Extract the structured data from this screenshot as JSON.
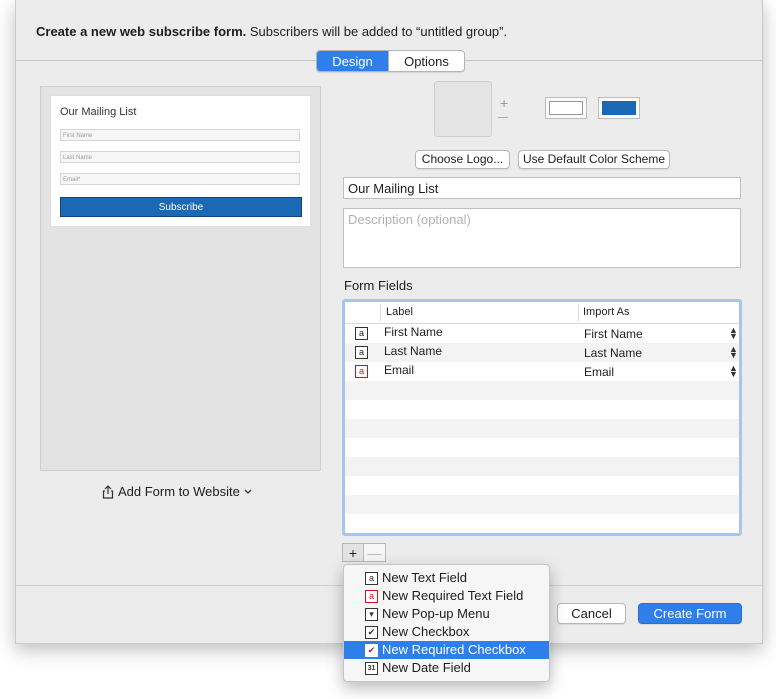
{
  "header": {
    "bold_text": "Create a new web subscribe form.",
    "rest_text": " Subscribers will be added to “untitled group”."
  },
  "tabs": [
    {
      "label": "Design",
      "active": true
    },
    {
      "label": "Options",
      "active": false
    }
  ],
  "preview": {
    "title": "Our Mailing List",
    "fields": [
      "First Name",
      "Last Name",
      "Email*"
    ],
    "subscribe_label": "Subscribe"
  },
  "add_form_label": "Add Form to Website",
  "logo": {
    "plus_glyph": "+",
    "choose_logo_label": "Choose Logo...",
    "default_color_label": "Use Default Color Scheme"
  },
  "colors": {
    "accent": "#2f7fea",
    "swatch_background": "#ffffff",
    "swatch_button": "#1b69b4"
  },
  "form": {
    "title_value": "Our Mailing List",
    "description_placeholder": "Description (optional)",
    "fields_label": "Form Fields"
  },
  "table": {
    "columns": [
      "Label",
      "Import As"
    ],
    "rows": [
      {
        "icon": "text-field-icon",
        "glyph": "a",
        "required": false,
        "label": "First Name",
        "import_as": "First Name"
      },
      {
        "icon": "text-field-icon",
        "glyph": "a",
        "required": false,
        "label": "Last Name",
        "import_as": "Last Name"
      },
      {
        "icon": "required-text-field-icon",
        "glyph": "a",
        "required": true,
        "label": "Email",
        "import_as": "Email"
      }
    ]
  },
  "add_remove": {
    "add_glyph": "+",
    "remove_glyph": "—"
  },
  "footer": {
    "cancel_label": "Cancel",
    "create_label": "Create Form"
  },
  "menu": {
    "items": [
      {
        "label": "New Text Field",
        "icon": "text-field-icon",
        "glyph": "a",
        "required": false,
        "selected": false
      },
      {
        "label": "New Required Text Field",
        "icon": "required-text-field-icon",
        "glyph": "a",
        "required": true,
        "selected": false
      },
      {
        "label": "New Pop-up Menu",
        "icon": "popup-menu-icon",
        "glyph": "▾",
        "required": false,
        "selected": false
      },
      {
        "label": "New Checkbox",
        "icon": "checkbox-icon",
        "glyph": "✔",
        "required": false,
        "selected": false
      },
      {
        "label": "New Required Checkbox",
        "icon": "required-checkbox-icon",
        "glyph": "✔",
        "required": true,
        "selected": true
      },
      {
        "label": "New Date Field",
        "icon": "calendar-icon",
        "glyph": "31",
        "required": false,
        "selected": false
      }
    ]
  }
}
